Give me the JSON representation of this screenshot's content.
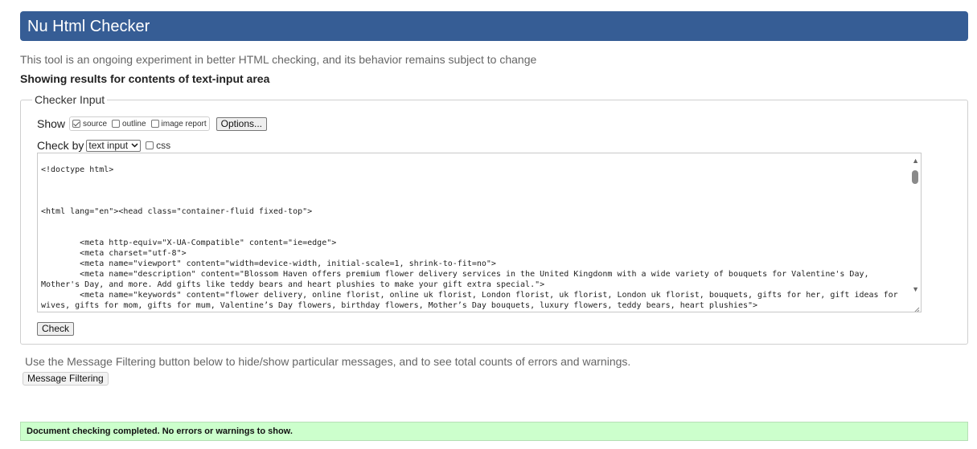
{
  "header": {
    "title": "Nu Html Checker"
  },
  "tagline": "This tool is an ongoing experiment in better HTML checking, and its behavior remains subject to change",
  "showing_results": "Showing results for contents of text-input area",
  "checker_input": {
    "legend": "Checker Input",
    "show_label": "Show",
    "show_options": [
      {
        "label": "source",
        "checked": true
      },
      {
        "label": "outline",
        "checked": false
      },
      {
        "label": "image report",
        "checked": false
      }
    ],
    "options_button": "Options...",
    "check_by_label": "Check by",
    "check_by_value": "text input",
    "css_label": "css",
    "css_checked": false,
    "source_text": "<!doctype html>\n\n\n\n<html lang=\"en\"><head class=\"container-fluid fixed-top\">\n\n\n        <meta http-equiv=\"X-UA-Compatible\" content=\"ie=edge\">\n        <meta charset=\"utf-8\">\n        <meta name=\"viewport\" content=\"width=device-width, initial-scale=1, shrink-to-fit=no\">\n        <meta name=\"description\" content=\"Blossom Haven offers premium flower delivery services in the United Kingdonm with a wide variety of bouquets for Valentine's Day,\nMother's Day, and more. Add gifts like teddy bears and heart plushies to make your gift extra special.\">\n        <meta name=\"keywords\" content=\"flower delivery, online florist, online uk florist, London florist, uk florist, London uk florist, bouquets, gifts for her, gift ideas for\nwives, gifts for mom, gifts for mum, Valentine’s Day flowers, birthday flowers, Mother’s Day bouquets, luxury flowers, teddy bears, heart plushies\">",
    "check_button": "Check"
  },
  "filter": {
    "note": "Use the Message Filtering button below to hide/show particular messages, and to see total counts of errors and warnings.",
    "button": "Message Filtering"
  },
  "result": {
    "message": "Document checking completed. No errors or warnings to show."
  },
  "colors": {
    "header_bg": "#365d95",
    "success_bg": "#ccffcc"
  }
}
